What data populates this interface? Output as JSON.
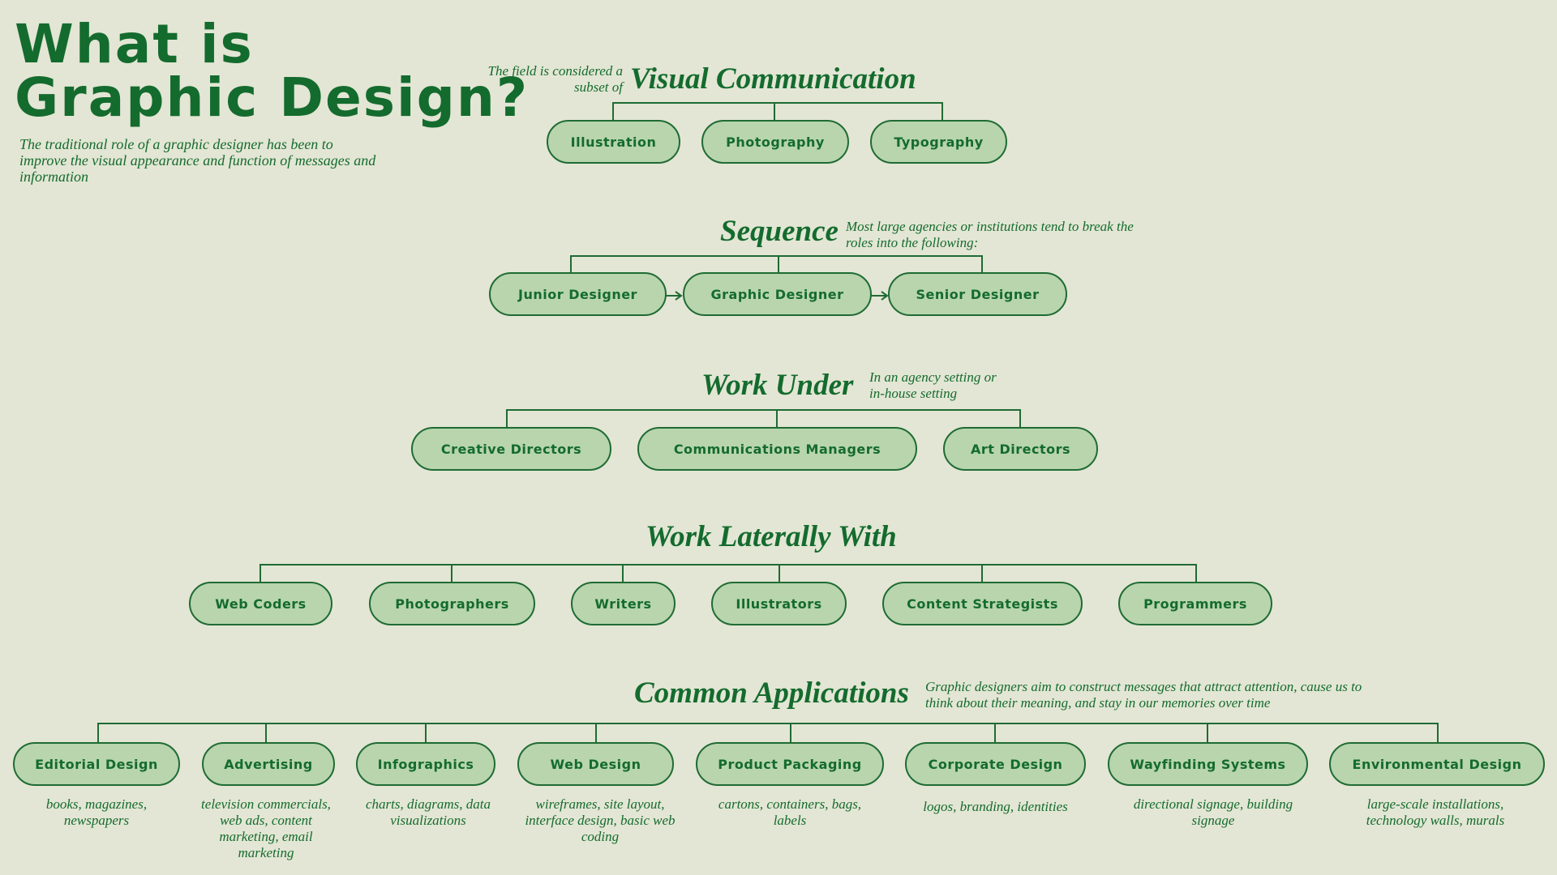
{
  "title": {
    "line1": "What is",
    "line2": "Graphic Design?"
  },
  "intro": "The traditional role of a graphic designer has been to improve the visual appearance and function of messages and information",
  "sections": {
    "visual": {
      "heading": "Visual Communication",
      "note": "The field is considered a subset of",
      "items": [
        "Illustration",
        "Photography",
        "Typography"
      ]
    },
    "sequence": {
      "heading": "Sequence",
      "note": "Most large agencies or institutions tend to break the roles into the following:",
      "items": [
        "Junior Designer",
        "Graphic Designer",
        "Senior Designer"
      ]
    },
    "under": {
      "heading": "Work Under",
      "note": "In an agency setting or in-house setting",
      "items": [
        "Creative Directors",
        "Communications Managers",
        "Art Directors"
      ]
    },
    "lateral": {
      "heading": "Work Laterally With",
      "items": [
        "Web Coders",
        "Photographers",
        "Writers",
        "Illustrators",
        "Content Strategists",
        "Programmers"
      ]
    },
    "applications": {
      "heading": "Common Applications",
      "note": "Graphic designers aim to construct messages that attract attention, cause us to think about their meaning, and stay in our memories over time",
      "items": [
        {
          "label": "Editorial Design",
          "desc": "books, magazines, newspapers"
        },
        {
          "label": "Advertising",
          "desc": "television commercials, web ads, content marketing, email marketing"
        },
        {
          "label": "Infographics",
          "desc": "charts, diagrams, data visualizations"
        },
        {
          "label": "Web Design",
          "desc": "wireframes, site layout, interface design, basic web coding"
        },
        {
          "label": "Product Packaging",
          "desc": "cartons, containers, bags, labels"
        },
        {
          "label": "Corporate Design",
          "desc": "logos, branding, identities"
        },
        {
          "label": "Wayfinding Systems",
          "desc": "directional signage, building signage"
        },
        {
          "label": "Environmental Design",
          "desc": "large-scale installations, technology walls, murals"
        }
      ]
    }
  },
  "colors": {
    "background": "#e3e6d4",
    "text": "#146b2e",
    "pill_fill": "#b8d5ad",
    "line": "#1f6b34"
  }
}
